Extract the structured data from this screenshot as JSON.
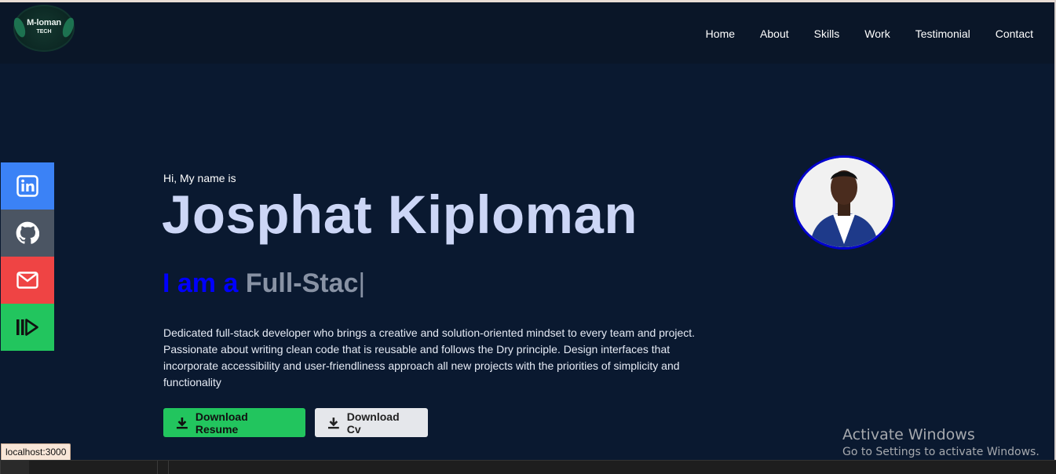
{
  "logo": {
    "line1": "M-loman",
    "line2": "TECH"
  },
  "nav": [
    "Home",
    "About",
    "Skills",
    "Work",
    "Testimonial",
    "Contact"
  ],
  "social": [
    {
      "name": "linkedin-icon",
      "color": "#3b82f6"
    },
    {
      "name": "github-icon",
      "color": "#4b5563"
    },
    {
      "name": "mail-icon",
      "color": "#ef4444"
    },
    {
      "name": "resume-icon",
      "color": "#22c55e"
    }
  ],
  "hero": {
    "greeting": "Hi, My name is",
    "name": "Josphat Kiploman",
    "role_prefix": "I am a",
    "role_typed": "Full-Stac",
    "cursor": "|",
    "bio": "Dedicated full-stack developer who brings a creative and solution-oriented mindset to every team and project. Passionate about writing clean code that is reusable and follows the Dry principle. Design interfaces that incorporate accessibility and user-friendliness approach all new projects with the priorities of simplicity and functionality"
  },
  "buttons": {
    "resume": "Download Resume",
    "cv": "Download Cv"
  },
  "activation": {
    "title": "Activate Windows",
    "subtitle": "Go to Settings to activate Windows."
  },
  "status_url": "localhost:3000",
  "colors": {
    "background": "#0a1930",
    "name": "#ccd6f6",
    "role_prefix": "#0000ff",
    "role_typed": "#8892a4",
    "resume_button": "#22c55e",
    "cv_button": "#e5e7eb"
  }
}
